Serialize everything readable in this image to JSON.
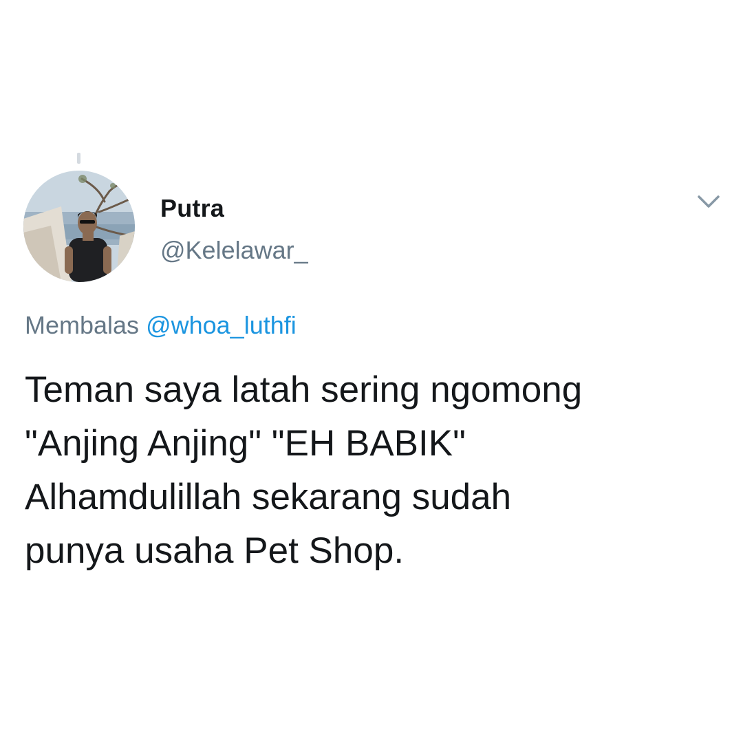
{
  "tweet": {
    "author": {
      "display_name": "Putra",
      "handle": "@Kelelawar_",
      "avatar": "profile-photo"
    },
    "menu_icon": "chevron-down-icon",
    "reply": {
      "prefix": "Membalas",
      "mention": "@whoa_luthfi"
    },
    "text_lines": [
      "Teman saya latah sering ngomong",
      "\"Anjing Anjing\" \"EH BABIK\"",
      "Alhamdulillah sekarang sudah",
      "punya usaha Pet Shop."
    ]
  },
  "colors": {
    "text_primary": "#14171a",
    "text_secondary": "#657786",
    "link": "#1b95e0",
    "thread_line": "#d4dae0"
  }
}
